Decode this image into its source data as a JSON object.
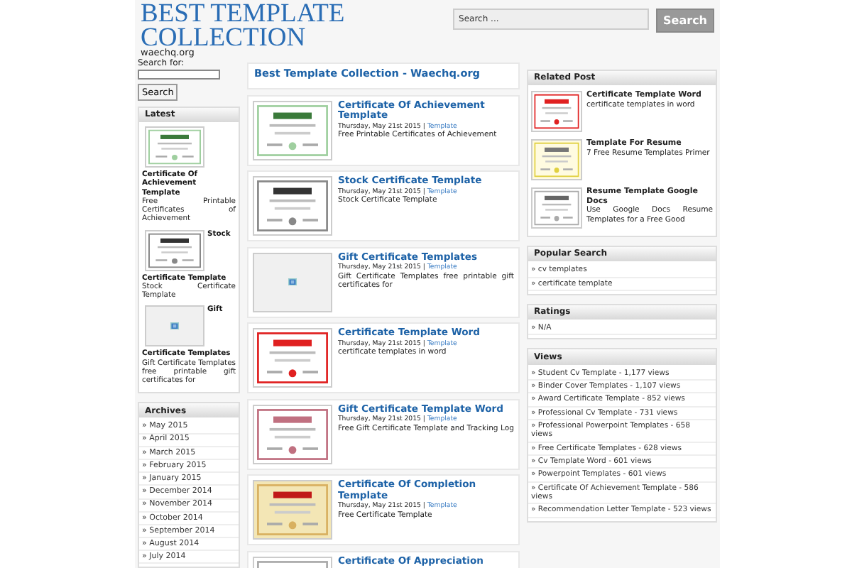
{
  "header": {
    "title": "BEST TEMPLATE COLLECTION",
    "subtitle": "waechq.org",
    "search": {
      "placeholder": "Search ...",
      "button": "Search"
    }
  },
  "left_sidebar": {
    "search_label": "Search for:",
    "search_button": "Search",
    "latest": {
      "heading": "Latest",
      "items": [
        {
          "kind": "picture",
          "title": "Certificate Of Achievement Template",
          "excerpt": "Free Printable Certificates of Achievement"
        },
        {
          "kind": "picture",
          "title": "Stock Certificate Template",
          "excerpt": "Stock Certificate Template"
        },
        {
          "kind": "picture",
          "title": "Gift Certificate Templates",
          "excerpt": "Gift Certificate Templates free printable gift certificates for"
        }
      ]
    },
    "archives": {
      "heading": "Archives",
      "items": [
        "» May 2015",
        "» April 2015",
        "» March 2015",
        "» February 2015",
        "» January 2015",
        "» December 2014",
        "» November 2014",
        "» October 2014",
        "» September 2014",
        "» August 2014",
        "» July 2014"
      ]
    }
  },
  "main": {
    "heading": "Best Template Collection - Waechq.org",
    "posts": [
      {
        "kind": "picture",
        "title": "Certificate Of Achievement Template",
        "date": "Thursday, May 21st 2015 |",
        "category": "Template",
        "excerpt": "Free Printable Certificates of Achievement"
      },
      {
        "kind": "picture",
        "title": "Stock Certificate Template",
        "date": "Thursday, May 21st 2015 |",
        "category": "Template",
        "excerpt": "Stock Certificate Template"
      },
      {
        "kind": "picture",
        "title": "Gift Certificate Templates",
        "date": "Thursday, May 21st 2015 |",
        "category": "Template",
        "excerpt": "Gift Certificate Templates free printable gift certificates for"
      },
      {
        "kind": "picture",
        "title": "Certificate Template Word",
        "date": "Thursday, May 21st 2015 |",
        "category": "Template",
        "excerpt": "certificate templates in word"
      },
      {
        "kind": "picture",
        "title": "Gift Certificate Template Word",
        "date": "Thursday, May 21st 2015 |",
        "category": "Template",
        "excerpt": "Free Gift Certificate Template and Tracking Log"
      },
      {
        "kind": "picture",
        "title": "Certificate Of Completion Template",
        "date": "Thursday, May 21st 2015 |",
        "category": "Template",
        "excerpt": "Free Certificate Template"
      },
      {
        "kind": "picture",
        "title": "Certificate Of Appreciation"
      }
    ]
  },
  "right_sidebar": {
    "related": {
      "heading": "Related Post",
      "items": [
        {
          "kind": "picture",
          "title": "Certificate Template Word",
          "excerpt": "certificate templates in word"
        },
        {
          "kind": "picture",
          "title": "Template For Resume",
          "excerpt": "7 Free Resume Templates Primer"
        },
        {
          "kind": "picture",
          "title": "Resume Template Google Docs",
          "excerpt": "Use Google Docs Resume Templates for a Free Good"
        }
      ]
    },
    "popular": {
      "heading": "Popular Search",
      "items": [
        "» cv templates",
        "» certificate template"
      ]
    },
    "ratings": {
      "heading": "Ratings",
      "items": [
        "» N/A"
      ]
    },
    "views": {
      "heading": "Views",
      "items": [
        "» Student Cv Template - 1,177 views",
        "» Binder Cover Templates - 1,107 views",
        "» Award Certificate Template - 852 views",
        "» Professional Cv Template - 731 views",
        "» Professional Powerpoint Templates - 658 views",
        "» Free Certificate Templates - 628 views",
        "» Cv Template Word - 601 views",
        "» Powerpoint Templates - 601 views",
        "» Certificate Of Achievement Template - 586 views",
        "» Recommendation Letter Template - 523 views"
      ]
    }
  }
}
